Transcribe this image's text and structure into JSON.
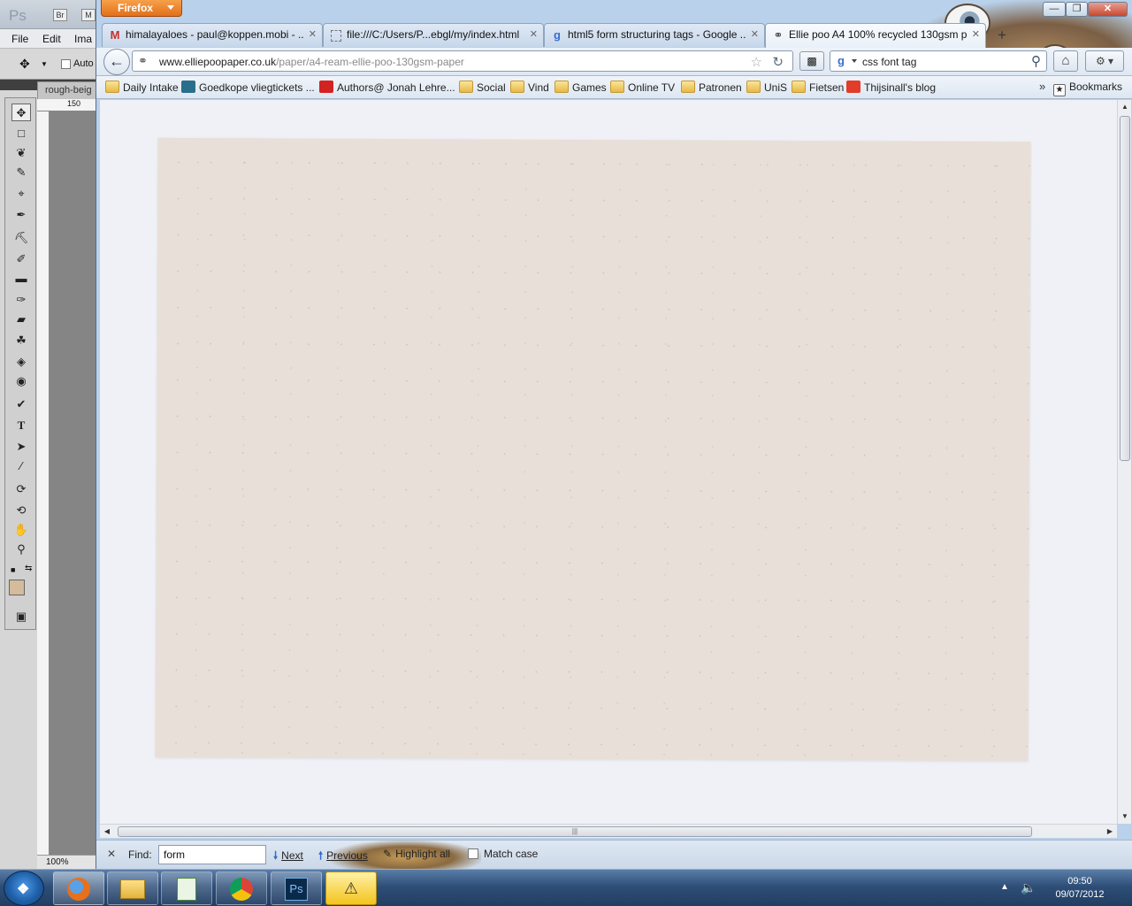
{
  "photoshop": {
    "logo": "Ps",
    "bridge_btn": "Br",
    "mini_btn": "M",
    "menu": [
      "File",
      "Edit",
      "Ima"
    ],
    "options_label": "Auto",
    "doc_tab": "rough-beig",
    "ruler_mark": "150",
    "zoom": "100%",
    "tools": [
      "move-icon",
      "marquee-icon",
      "lasso-icon",
      "quick-select-icon",
      "crop-icon",
      "eyedropper-icon",
      "healing-icon",
      "brush-icon",
      "stamp-icon",
      "history-brush-icon",
      "eraser-icon",
      "bucket-icon",
      "blur-icon",
      "dodge-icon",
      "pen-icon",
      "type-icon",
      "path-select-icon",
      "line-icon",
      "3d-rotate-icon",
      "3d-orbit-icon",
      "hand-icon",
      "zoom-icon"
    ],
    "foreground_color": "#d4bb9b"
  },
  "firefox": {
    "app_button": "Firefox",
    "tabs": [
      {
        "label": "himalayaloes - paul@koppen.mobi - ...",
        "icon": "gmail-icon"
      },
      {
        "label": "file:///C:/Users/P...ebgl/my/index.html",
        "icon": "blank-page-icon"
      },
      {
        "label": "html5 form structuring tags - Google ...",
        "icon": "google-icon"
      },
      {
        "label": "Ellie poo A4 100% recycled 130gsm p...",
        "icon": "site-icon"
      }
    ],
    "url_domain": "www.elliepoopaper.co.uk",
    "url_path": "/paper/a4-ream-ellie-poo-130gsm-paper",
    "search_value": "css font tag",
    "bookmarks": [
      {
        "label": "Daily Intake",
        "icon": "folder-icon"
      },
      {
        "label": "Goedkope vliegtickets ...",
        "icon": "site-icon"
      },
      {
        "label": "Authors@ Jonah Lehre...",
        "icon": "youtube-icon"
      },
      {
        "label": "Social",
        "icon": "folder-icon"
      },
      {
        "label": "Vind",
        "icon": "folder-icon"
      },
      {
        "label": "Games",
        "icon": "folder-icon"
      },
      {
        "label": "Online TV",
        "icon": "folder-icon"
      },
      {
        "label": "Patronen",
        "icon": "folder-icon"
      },
      {
        "label": "UniS",
        "icon": "folder-icon"
      },
      {
        "label": "Fietsen",
        "icon": "folder-icon"
      },
      {
        "label": "Thijsinall's blog",
        "icon": "blog-icon"
      }
    ],
    "bookmarks_menu": "Bookmarks",
    "find": {
      "label": "Find:",
      "value": "form",
      "next": "Next",
      "previous": "Previous",
      "highlight_all": "Highlight all",
      "match_case": "Match case"
    }
  },
  "taskbar": {
    "items": [
      "firefox-icon",
      "explorer-icon",
      "notepad-icon",
      "chrome-icon",
      "photoshop-icon",
      "warning-icon"
    ],
    "photoshop_label": "Ps",
    "time": "09:50",
    "date": "09/07/2012"
  }
}
